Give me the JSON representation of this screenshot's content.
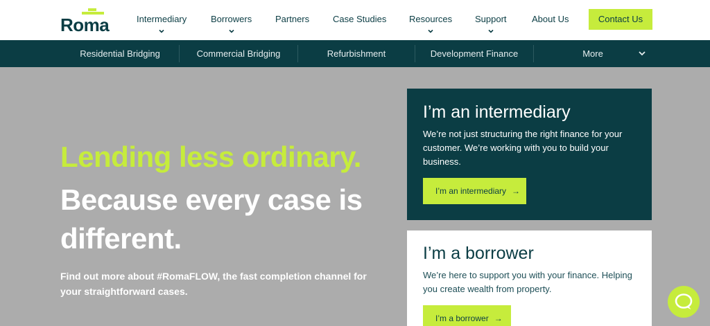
{
  "brand": {
    "name": "Roma"
  },
  "nav": {
    "items": [
      {
        "label": "Intermediary",
        "has_dropdown": true
      },
      {
        "label": "Borrowers",
        "has_dropdown": true
      },
      {
        "label": "Partners",
        "has_dropdown": false
      },
      {
        "label": "Case Studies",
        "has_dropdown": false
      },
      {
        "label": "Resources",
        "has_dropdown": true
      },
      {
        "label": "Support",
        "has_dropdown": true
      },
      {
        "label": "About Us",
        "has_dropdown": false
      }
    ],
    "cta_label": "Contact Us"
  },
  "subnav": {
    "items": [
      {
        "label": "Residential Bridging"
      },
      {
        "label": "Commercial Bridging"
      },
      {
        "label": "Refurbishment"
      },
      {
        "label": "Development Finance"
      },
      {
        "label": "More"
      }
    ]
  },
  "hero": {
    "headline_accent": "Lending less ordinary.",
    "headline_main": "Because every case is different.",
    "subtext": "Find out more about #RomaFLOW, the fast completion channel for your straightforward cases."
  },
  "cards": {
    "intermediary": {
      "title": "I’m an intermediary",
      "body": "We’re not just structuring the right finance for your customer. We’re working with you to build your business.",
      "button_label": "I’m an intermediary",
      "arrow": "→"
    },
    "borrower": {
      "title": "I’m a borrower",
      "body": "We’re here to support you with your finance. Helping you create wealth from property.",
      "button_label": "I’m a borrower",
      "arrow": "→"
    }
  },
  "icons": {
    "chevron": "chevron-down-icon",
    "chat": "chat-bubble-icon",
    "arrow": "arrow-right-icon"
  },
  "colors": {
    "primary_dark": "#0b3d44",
    "accent_lime": "#c6ec3c",
    "hero_bg": "#acacac",
    "white": "#ffffff"
  }
}
